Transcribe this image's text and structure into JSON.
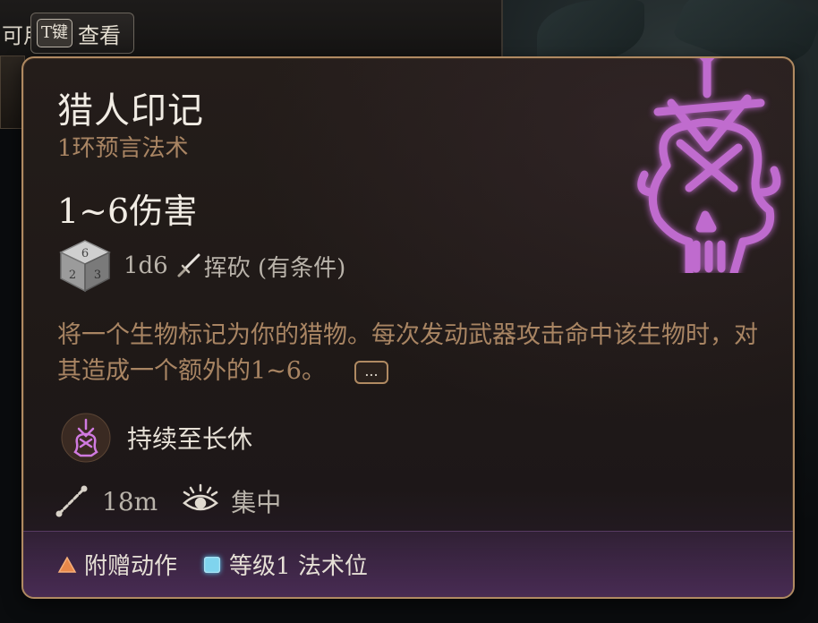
{
  "hint": {
    "prefix": "可用",
    "key": "T键",
    "action": "查看"
  },
  "spell": {
    "title": "猎人印记",
    "subtitle": "1环预言法术",
    "damage": "1~6伤害",
    "dice": "1d6",
    "damage_type": "挥砍 (有条件)",
    "description": "将一个生物标记为你的猎物。每次发动武器攻击命中该生物时，对其造成一个额外的1~6。",
    "more_label": "...",
    "duration": "持续至长休",
    "range": "18m",
    "concentration": "集中",
    "footer": {
      "action": "附赠动作",
      "slot": "等级1 法术位"
    }
  },
  "colors": {
    "border": "#b08a62",
    "title": "#f1ece4",
    "subtitle": "#a98563",
    "skull_glow": "#c86fd8",
    "action_triangle": "#e8884a",
    "slot_square": "#7fd4ee"
  },
  "icons": {
    "dice": "d6-dice-icon",
    "damage_type": "sword-icon",
    "duration": "hunters-mark-skull-icon",
    "range": "range-line-icon",
    "concentration": "concentration-eye-icon",
    "action": "orange-triangle-icon",
    "slot": "blue-square-icon",
    "spell_art": "glowing-skull-icon"
  }
}
